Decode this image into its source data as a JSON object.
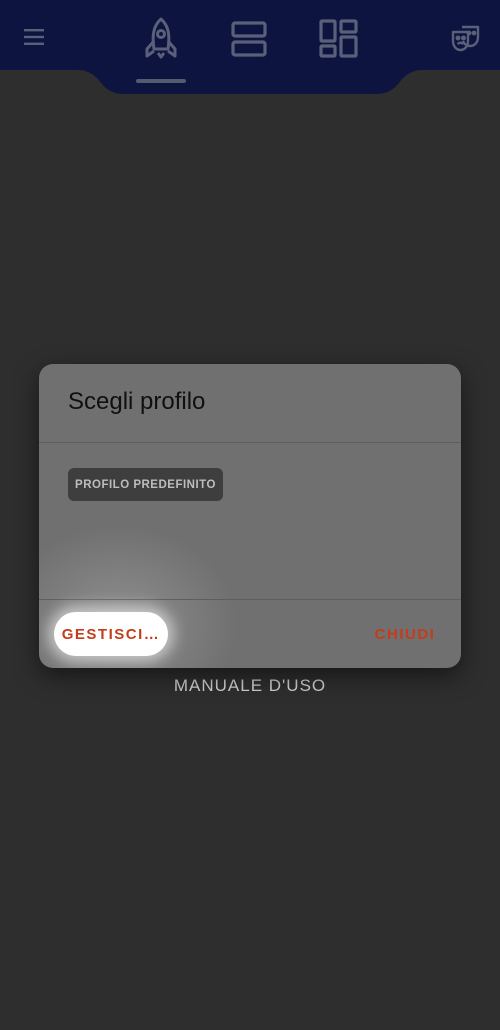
{
  "app_bar": {
    "background_color": "#0d1440",
    "icons": [
      "menu-icon",
      "rocket-icon",
      "rows-layout-icon",
      "dashboard-layout-icon",
      "theater-masks-icon"
    ],
    "active_tab": "rocket"
  },
  "background_link": {
    "label": "MANUALE D'USO"
  },
  "dialog": {
    "title": "Scegli profilo",
    "profiles": [
      {
        "label": "PROFILO PREDEFINITO"
      }
    ],
    "manage_button_label": "GESTISCI…",
    "close_button_label": "CHIUDI",
    "accent_color": "#c43c1b"
  }
}
